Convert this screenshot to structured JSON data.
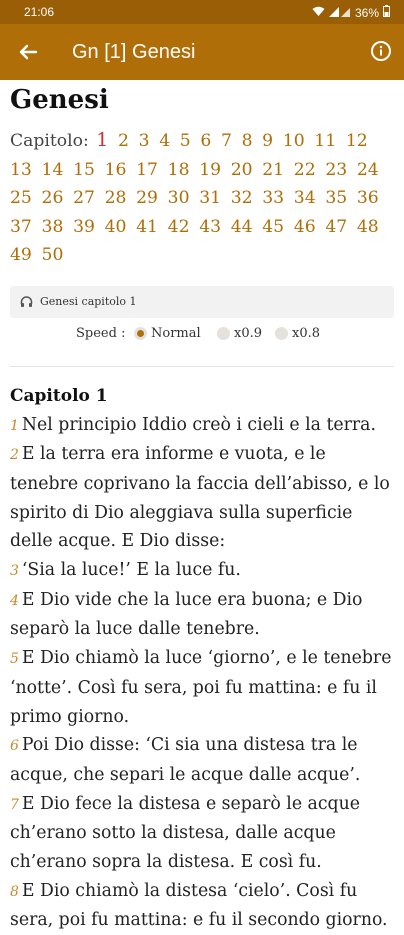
{
  "status": {
    "time": "21:06",
    "battery": "36%"
  },
  "appbar": {
    "title": "Gn [1] Genesi"
  },
  "book": {
    "title": "Genesi"
  },
  "chapters": {
    "label": "Capitolo:",
    "current": "1",
    "items": [
      "2",
      "3",
      "4",
      "5",
      "6",
      "7",
      "8",
      "9",
      "10",
      "11",
      "12",
      "13",
      "14",
      "15",
      "16",
      "17",
      "18",
      "19",
      "20",
      "21",
      "22",
      "23",
      "24",
      "25",
      "26",
      "27",
      "28",
      "29",
      "30",
      "31",
      "32",
      "33",
      "34",
      "35",
      "36",
      "37",
      "38",
      "39",
      "40",
      "41",
      "42",
      "43",
      "44",
      "45",
      "46",
      "47",
      "48",
      "49",
      "50"
    ]
  },
  "audio": {
    "label": "Genesi capitolo 1"
  },
  "speed": {
    "label": "Speed :",
    "options": [
      "Normal",
      "x0.9",
      "x0.8"
    ],
    "selected": "Normal"
  },
  "chapter": {
    "heading": "Capitolo 1",
    "verses": [
      {
        "n": "1",
        "text": "Nel principio Iddio creò i cieli e la terra."
      },
      {
        "n": "2",
        "text": "E la terra era informe e vuota, e le tenebre coprivano la faccia dell’abisso, e lo spirito di Dio aleggiava sulla superficie delle acque. E Dio disse:"
      },
      {
        "n": "3",
        "text": "‘Sia la luce!’ E la luce fu."
      },
      {
        "n": "4",
        "text": "E Dio vide che la luce era buona; e Dio separò la luce dalle tenebre."
      },
      {
        "n": "5",
        "text": "E Dio chiamò la luce ‘giorno’, e le tenebre ‘notte’. Così fu sera, poi fu mattina: e fu il primo giorno."
      },
      {
        "n": "6",
        "text": "Poi Dio disse: ‘Ci sia una distesa tra le acque, che separi le acque dalle acque’."
      },
      {
        "n": "7",
        "text": "E Dio fece la distesa e separò le acque ch’erano sotto la distesa, dalle acque ch’erano sopra la distesa. E così fu."
      },
      {
        "n": "8",
        "text": "E Dio chiamò la distesa ‘cielo’. Così fu sera, poi fu mattina: e fu il secondo giorno."
      }
    ]
  }
}
